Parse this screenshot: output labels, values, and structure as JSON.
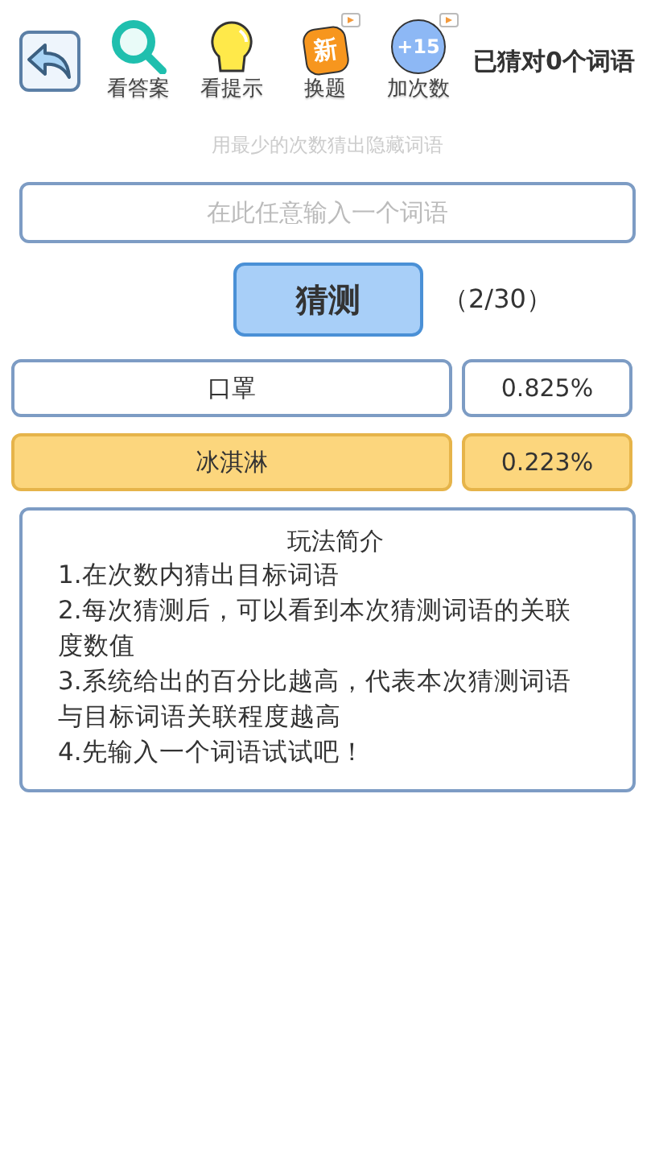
{
  "toolbar": {
    "tools": [
      {
        "kind": "answer",
        "label": "看答案"
      },
      {
        "kind": "hint",
        "label": "看提示"
      },
      {
        "kind": "new",
        "label": "换题",
        "badge": "新",
        "video": true
      },
      {
        "kind": "more",
        "label": "加次数",
        "badge": "+15",
        "video": true
      }
    ],
    "status": "已猜对0个词语"
  },
  "subtitle": "用最少的次数猜出隐藏词语",
  "search": {
    "placeholder": "在此任意输入一个词语"
  },
  "guess_button": "猜测",
  "attempts": "（2/30）",
  "guesses": [
    {
      "word": "口罩",
      "score": "0.825%",
      "selected": false
    },
    {
      "word": "冰淇淋",
      "score": "0.223%",
      "selected": true
    }
  ],
  "rules": {
    "title": "玩法简介",
    "lines": [
      "1.在次数内猜出目标词语",
      "2.每次猜测后，可以看到本次猜测词语的关联度数值",
      "3.系统给出的百分比越高，代表本次猜测词语与目标词语关联程度越高",
      "4.先输入一个词语试试吧！"
    ]
  }
}
